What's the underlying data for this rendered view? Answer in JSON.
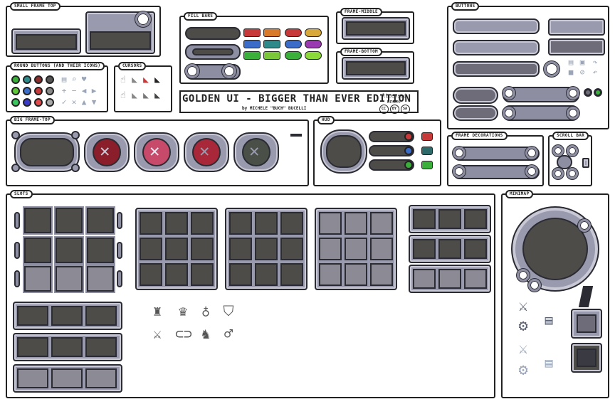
{
  "sections": {
    "small_frame_top": "SMALL FRAME TOP",
    "round_buttons": "ROUND BUTTONS (AND THEIR ICONS)",
    "cursors": "CURSORS",
    "fill_bars": "FILL BARS",
    "frame_middle": "FRAME-MIDDLE",
    "frame_bottom": "FRAME-BOTTOM",
    "buttons": "BUTTONS",
    "big_frame_top": "BIG FRAME-TOP",
    "hud": "HUD",
    "frame_decorations": "FRAME DECORATIONS",
    "scroll_bar": "SCROLL BAR",
    "slots": "SLOTS",
    "minimap": "MINIMAP"
  },
  "banner": {
    "title": "GOLDEN UI - BIGGER THAN EVER EDITION",
    "author": "by MICHELE \"BUCH\" BUCELLI",
    "license": "licensed under",
    "cc": "CC",
    "by": "BY",
    "sa": "SA"
  },
  "colors": {
    "frame": "#9a9aae",
    "inner": "#4e4c48",
    "outline": "#2b2b33",
    "red": "#c83a3a",
    "blue": "#3a6cc8",
    "green": "#3ab03a",
    "gold": "#d8a838",
    "purple": "#9a3ab0"
  },
  "icons": {
    "round_buttons": [
      "doc-icon",
      "search-icon",
      "heart-icon",
      "plus-icon",
      "minus-icon",
      "arrow-left-icon",
      "arrow-right-icon",
      "check-icon",
      "cross-icon",
      "arrow-up-icon",
      "arrow-down-icon"
    ],
    "equipment": [
      "helmet-icon",
      "armor-icon",
      "amulet-icon",
      "shield-icon",
      "sword-icon",
      "belt-icon",
      "boots-icon",
      "ring-icon"
    ],
    "minimap": [
      "crossed-swords-icon",
      "gear-icon",
      "menu-icon"
    ]
  }
}
